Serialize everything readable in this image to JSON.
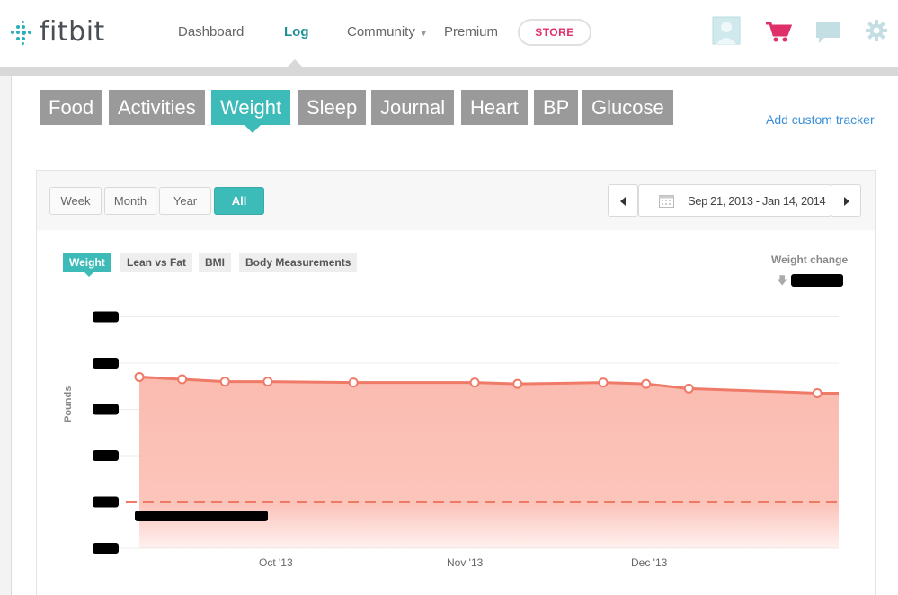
{
  "brand": {
    "name": "fitbit",
    "color": "#2ab0b8"
  },
  "nav": {
    "links": [
      "Dashboard",
      "Log",
      "Community",
      "Premium"
    ],
    "active": "Log",
    "store_label": "STORE",
    "icons": [
      "profile-avatar-icon",
      "cart-icon",
      "messages-icon",
      "settings-gear-icon"
    ]
  },
  "trackers": {
    "tabs": [
      "Food",
      "Activities",
      "Weight",
      "Sleep",
      "Journal",
      "Heart",
      "BP",
      "Glucose"
    ],
    "active": "Weight",
    "add_custom": "Add custom tracker"
  },
  "range": {
    "buttons": [
      "Week",
      "Month",
      "Year",
      "All"
    ],
    "active": "All",
    "date_range": "Sep 21, 2013 - Jan 14, 2014"
  },
  "chart_tabs": {
    "tabs": [
      "Weight",
      "Lean vs Fat",
      "BMI",
      "Body Measurements"
    ],
    "active": "Weight"
  },
  "weight_change": {
    "label": "Weight change"
  },
  "colors": {
    "accent": "#3dbbb9",
    "line": "#f07a68",
    "fill": "#fbbbb0",
    "goal": "#ee7a66"
  },
  "chart_data": {
    "type": "area",
    "ylabel": "Pounds",
    "x_ticks": [
      "Oct '13",
      "Nov '13",
      "Dec '13"
    ],
    "y_range_relative": [
      0,
      5
    ],
    "series": [
      {
        "x": [
          "2013-09-21",
          "2013-09-27",
          "2013-10-03",
          "2013-10-09",
          "2013-10-21",
          "2013-11-07",
          "2013-11-13",
          "2013-11-25",
          "2013-12-01",
          "2013-12-07",
          "2013-12-25"
        ],
        "values": [
          3.7,
          3.65,
          3.6,
          3.6,
          3.58,
          3.58,
          3.55,
          3.58,
          3.55,
          3.45,
          3.35
        ]
      }
    ],
    "goal_line": 1.0,
    "redacted": [
      "y tick labels",
      "goal label",
      "weight change value"
    ]
  }
}
